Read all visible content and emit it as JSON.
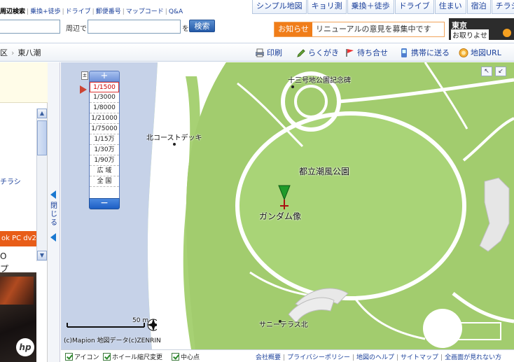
{
  "topnav": {
    "left_links": [
      "周辺検索",
      "乗換+徒歩",
      "ドライブ",
      "郵便番号",
      "マップコード",
      "Q&A"
    ],
    "tabs": [
      "シンプル地図",
      "キョリ測",
      "乗換＋徒歩",
      "ドライブ",
      "住まい",
      "宿泊",
      "チラシ"
    ]
  },
  "search": {
    "nearby_label": "周辺で",
    "suffix_label": "を",
    "button": "検索"
  },
  "notice": {
    "badge": "お知らせ",
    "text": "リニューアルの意見を募集中です"
  },
  "banner": {
    "line1": "東京",
    "line2": "お取りよせ"
  },
  "breadcrumb": {
    "prev": "区",
    "current": "東八潮"
  },
  "toolbar": {
    "print": "印刷",
    "rakugaki": "らくがき",
    "machiawase": "待ち合せ",
    "mobile": "携帯に送る",
    "mapurl": "地図URL"
  },
  "leftpanel": {
    "chirashi": "チラシ",
    "ad_title": "ok PC dv2",
    "ad_line1": "O",
    "ad_line2": "プ",
    "ad_logo": "hp",
    "toggle_label": "閉じる"
  },
  "zoom": {
    "plus": "+",
    "minus": "−",
    "levels": [
      "1/1500",
      "1/3000",
      "1/8000",
      "1/21000",
      "1/75000",
      "1/15万",
      "1/30万",
      "1/90万",
      "広 域",
      "全 国"
    ],
    "selected": "1/1500"
  },
  "map": {
    "labels": {
      "monument": "十三号地公園記念碑",
      "north_coast": "北コーストデッキ",
      "park": "都立潮風公園",
      "gundam": "ガンダム像",
      "terrace": "サニーテラス北"
    },
    "scale_label": "50 m",
    "copyright": "(c)Mapion 地図データ(c)ZENRIN",
    "marker_color": "#1f9b2a"
  },
  "bottombar": {
    "checks": [
      "アイコン",
      "ホイール縮尺変更",
      "中心点"
    ],
    "links": [
      "会社概要",
      "プライバシーポリシー",
      "地図のヘルプ",
      "サイトマップ",
      "全画面が見れない方"
    ]
  }
}
